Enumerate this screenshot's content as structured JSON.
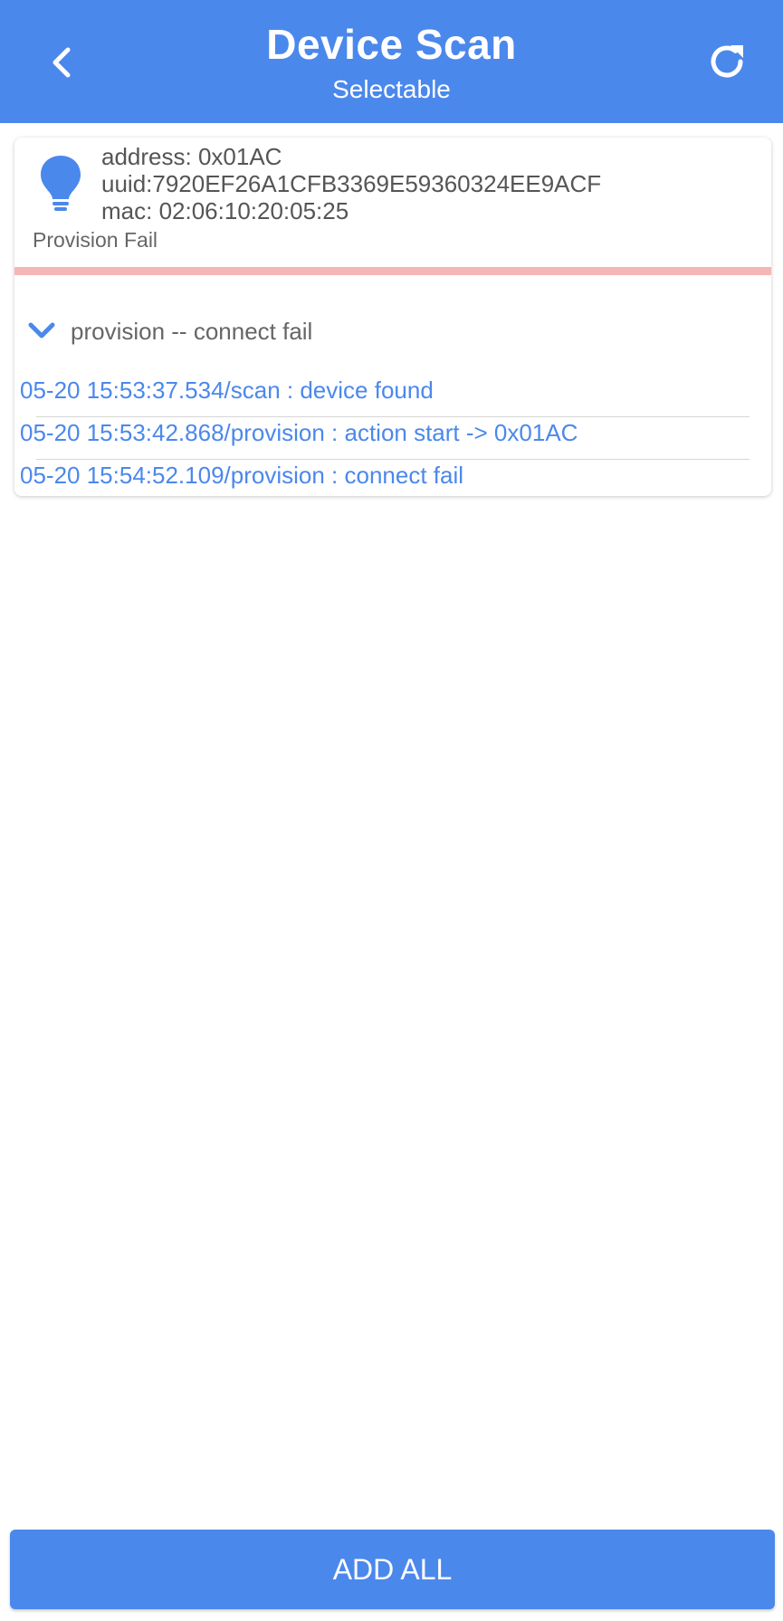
{
  "app_bar": {
    "title": "Device Scan",
    "subtitle": "Selectable",
    "back_icon": "chevron-left-icon",
    "refresh_icon": "refresh-icon",
    "color": "#4b88ec"
  },
  "device": {
    "icon": "lightbulb-icon",
    "address": "address: 0x01AC",
    "uuid": "uuid:7920EF26A1CFB3369E59360324EE9ACF",
    "mac": "mac: 02:06:10:20:05:25",
    "status": "Provision Fail",
    "status_color": "#f4b6b6"
  },
  "log": {
    "toggle_icon": "chevron-down-icon",
    "title": "provision -- connect fail",
    "entries": [
      "05-20 15:53:37.534/scan : device found",
      "05-20 15:53:42.868/provision : action start -> 0x01AC",
      "05-20 15:54:52.109/provision : connect fail"
    ]
  },
  "footer": {
    "add_all_label": "ADD ALL"
  }
}
